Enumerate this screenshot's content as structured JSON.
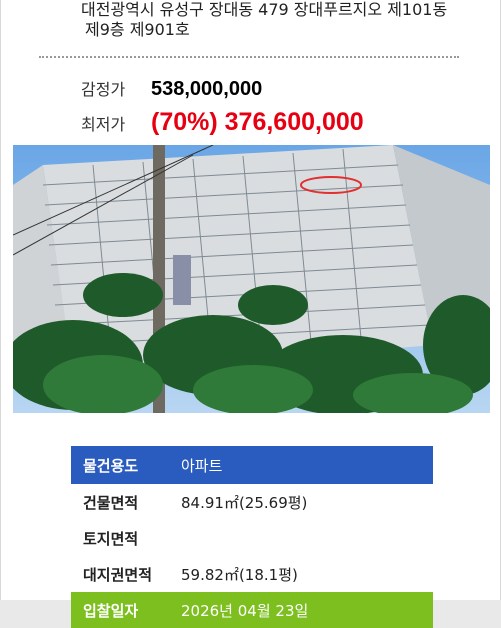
{
  "address": {
    "line1": "대전광역시 유성구 장대동 479 장대푸르지오 제101동",
    "line2": "제9층 제901호"
  },
  "prices": {
    "appraisal_label": "감정가",
    "appraisal_value": "538,000,000",
    "minimum_label": "최저가",
    "minimum_value": "(70%) 376,600,000"
  },
  "photo": {
    "description_icon": "apartment-photo"
  },
  "info": {
    "rows": [
      {
        "key": "물건용도",
        "value": "아파트"
      },
      {
        "key": "건물면적",
        "value": "84.91㎡(25.69평)"
      },
      {
        "key": "토지면적",
        "value": ""
      },
      {
        "key": "대지권면적",
        "value": "59.82㎡(18.1평)"
      },
      {
        "key": "입찰일자",
        "value": "2026년 04월 23일"
      }
    ]
  },
  "colors": {
    "accent_blue": "#2a5cbf",
    "accent_green": "#7cbf1f",
    "price_red": "#e60012"
  }
}
